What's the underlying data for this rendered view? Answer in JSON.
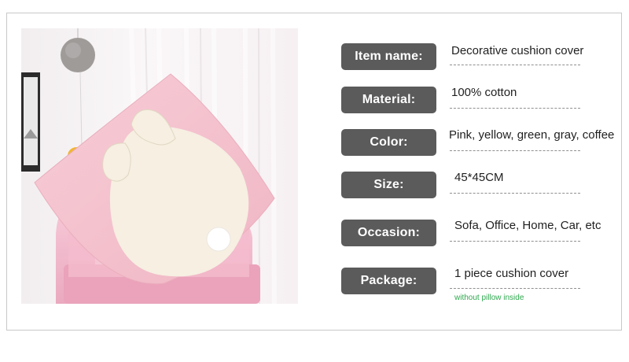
{
  "rows": [
    {
      "label": "Item name:",
      "value": "Decorative cushion cover"
    },
    {
      "label": "Material:",
      "value": "100% cotton"
    },
    {
      "label": "Color:",
      "value": "Pink, yellow, green, gray, coffee"
    },
    {
      "label": "Size:",
      "value": "45*45CM"
    },
    {
      "label": "Occasion:",
      "value": "Sofa, Office, Home, Car, etc"
    },
    {
      "label": "Package:",
      "value": "1 piece  cushion cover"
    }
  ],
  "package_note": "without pillow inside",
  "colors": {
    "label_background": "#5b5b5b",
    "label_text": "#ffffff",
    "note_text": "#2fa84f",
    "cushion_pink": "#f4c4cf",
    "chair_pink": "#f3b9cb"
  },
  "image": {
    "subject": "pink cushion cover with cream bunny shape and white pom-pom tail on a pink armchair"
  }
}
